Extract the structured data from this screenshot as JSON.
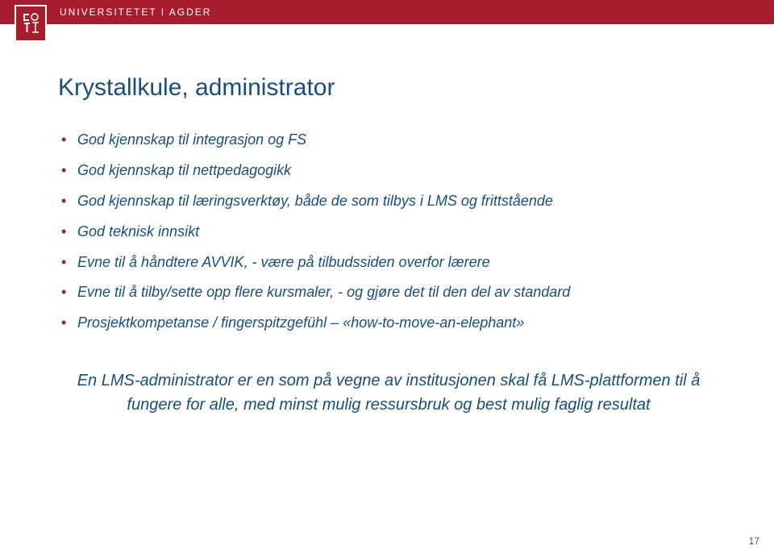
{
  "header": {
    "institution": "UNIVERSITETET I AGDER"
  },
  "title": "Krystallkule, administrator",
  "bullets": [
    "God kjennskap til integrasjon og FS",
    "God kjennskap til nettpedagogikk",
    "God kjennskap til læringsverktøy, både de som tilbys i LMS og frittstående",
    "God teknisk innsikt",
    "Evne til å håndtere AVVIK, - være på tilbudssiden overfor lærere",
    "Evne til å tilby/sette opp flere kursmaler, - og gjøre det til den del av standard",
    "Prosjektkompetanse / fingerspitzgefühl – «how-to-move-an-elephant»"
  ],
  "summary": "En LMS-administrator er en som på vegne av institusjonen skal få LMS-plattformen til å fungere for alle, med minst mulig ressursbruk og best mulig faglig resultat",
  "page_number": "17"
}
